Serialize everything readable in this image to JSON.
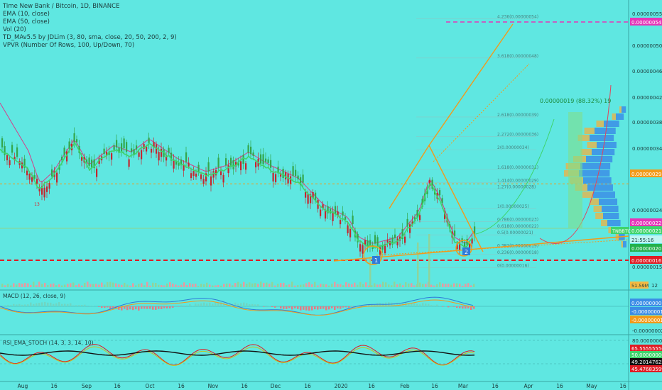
{
  "header": {
    "title": "Time New Bank / Bitcoin, 1D, BINANCE",
    "indicators": [
      "EMA (10, close)",
      "EMA (50, close)",
      "Vol (20)",
      "TD_MAv5.5 by JDLim (3, 80, sma, close, 20, 50, 200, 2, 9)",
      "VPVR (Number Of Rows, 100, Up/Down, 70)"
    ]
  },
  "colors": {
    "background": "#5fe7e1",
    "up": "#33a64b",
    "down": "#c4262e",
    "ema10": "#3fd46c",
    "ema50": "#d43f8a",
    "fib": "#d4a017",
    "accent_red": "#e01b24",
    "magenta": "#e535b8",
    "blue_vol": "#3b8de6",
    "orange": "#f39a19"
  },
  "price_axis": {
    "ticks": [
      "0.00000055",
      "0.00000050",
      "0.00000046",
      "0.00000042",
      "0.00000038",
      "0.00000034",
      "0.00000029",
      "0.00000024",
      "0.00000020",
      "0.00000015"
    ],
    "badges": [
      {
        "label": "0.00000054",
        "color": "#e535b8"
      },
      {
        "label": "0.00000029",
        "color": "#f39a19"
      },
      {
        "label": "0.00000022",
        "color": "#e535b8"
      },
      {
        "label": "0.00000021",
        "color": "#3fd46c"
      },
      {
        "label": "21:55:16",
        "color": "#bff5f3"
      },
      {
        "label": "0.00000020",
        "color": "#22b14c"
      },
      {
        "label": "0.00000016",
        "color": "#e01b24"
      }
    ],
    "symbol_tag": "TNBBTC",
    "volume_badge": "51.59M",
    "volume_tick": "12"
  },
  "fib": [
    {
      "label": "4.236(0.00000054)"
    },
    {
      "label": "3.618(0.00000048)"
    },
    {
      "label": "2.618(0.00000039)"
    },
    {
      "label": "2.272(0.00000036)"
    },
    {
      "label": "2(0.00000034)"
    },
    {
      "label": "1.618(0.00000031)"
    },
    {
      "label": "1.414(0.00000029)"
    },
    {
      "label": "1.27(0.00000028)"
    },
    {
      "label": "1(0.00000025)"
    },
    {
      "label": "0.786(0.00000023)"
    },
    {
      "label": "0.618(0.00000022)"
    },
    {
      "label": "0.5(0.00000021)"
    },
    {
      "label": "0.382(0.00000019)"
    },
    {
      "label": "0.236(0.00000018)"
    },
    {
      "label": "0(0.00000016)"
    }
  ],
  "target_label": "0.00000019 (88.32%) 19",
  "wave_labels": [
    "1",
    "2"
  ],
  "bar_marker": "13",
  "macd": {
    "title": "MACD (12, 26, close, 9)",
    "ticks": [
      "0.00000000",
      "-0.00000001",
      "-0.00000001",
      "-0.00000002"
    ],
    "badges": [
      {
        "label": "0.00000000",
        "color": "#3b8de6"
      },
      {
        "label": "-0.00000001",
        "color": "#3b8de6"
      },
      {
        "label": "-0.00000001",
        "color": "#f39a19"
      }
    ]
  },
  "rsi": {
    "title": "RSI_EMA_STOCH (14, 3, 3, 14, 10)",
    "ticks": [
      "80.00000000",
      "20.00000000"
    ],
    "badges": [
      {
        "label": "65.55555556",
        "color": "#e01b24"
      },
      {
        "label": "50.00000000",
        "color": "#3fd46c"
      },
      {
        "label": "49.20147623",
        "color": "#111111"
      },
      {
        "label": "45.47683599",
        "color": "#e01b24"
      }
    ]
  },
  "time_axis": [
    "Aug",
    "16",
    "Sep",
    "16",
    "Oct",
    "16",
    "Nov",
    "16",
    "Dec",
    "16",
    "2020",
    "16",
    "Feb",
    "16",
    "Mar",
    "16",
    "Apr",
    "16",
    "May",
    "16"
  ],
  "chart_data": {
    "type": "candlestick",
    "title": "Time New Bank / Bitcoin, 1D, BINANCE",
    "x_range": [
      "2019-07-29",
      "2020-05-20"
    ],
    "y_range": [
      1.3e-07,
      5.6e-07
    ],
    "x": [
      "Aug",
      "Sep",
      "Oct",
      "Nov",
      "Dec",
      "2020",
      "Feb",
      "Mar"
    ],
    "close_monthly_approx": [
      3.4e-07,
      3.2e-07,
      3.3e-07,
      2.8e-07,
      2.9e-07,
      2e-07,
      2.5e-07,
      2.1e-07
    ],
    "levels": {
      "resistance": 5.4e-07,
      "support": 1.6e-07,
      "last": 2.1e-07,
      "target_pct": "88.32%"
    }
  }
}
